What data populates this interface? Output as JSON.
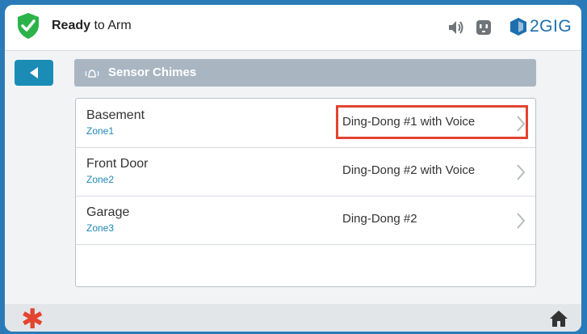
{
  "header": {
    "status_strong": "Ready",
    "status_rest": " to Arm",
    "brand_text": "2GIG",
    "icons": [
      "shield-check-icon",
      "moon-icon",
      "speaker-icon",
      "outlet-icon",
      "2gig-logo-icon"
    ]
  },
  "page": {
    "title": "Sensor Chimes",
    "title_icon": "chime-icon",
    "back_icon": "back-arrow-icon"
  },
  "sensors": [
    {
      "name": "Basement",
      "zone": "Zone1",
      "chime": "Ding-Dong #1 with Voice",
      "highlighted": true
    },
    {
      "name": "Front Door",
      "zone": "Zone2",
      "chime": "Ding-Dong #2 with Voice",
      "highlighted": false
    },
    {
      "name": "Garage",
      "zone": "Zone3",
      "chime": "Ding-Dong #2",
      "highlighted": false
    }
  ],
  "footer": {
    "icons": [
      "asterisk-icon",
      "home-icon"
    ]
  },
  "colors": {
    "accent": "#1a8cb6",
    "highlight": "#e2442f",
    "zone_text": "#1f88b8",
    "title_bar": "#a9b6c2"
  }
}
